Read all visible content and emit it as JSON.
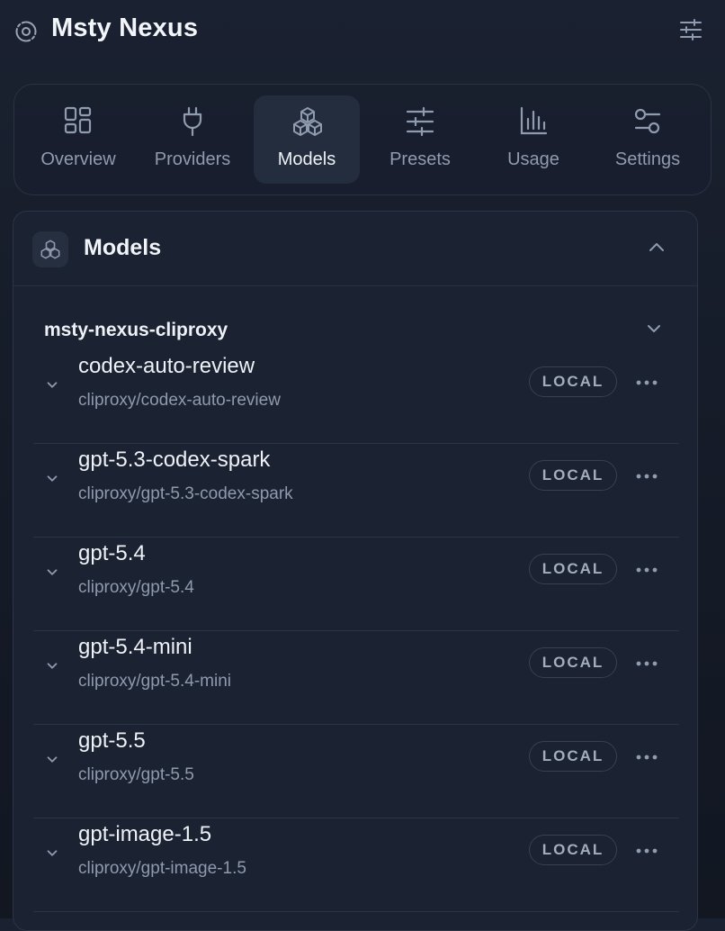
{
  "app": {
    "title": "Msty Nexus"
  },
  "nav": {
    "tabs": [
      {
        "label": "Overview",
        "icon": "grid-icon"
      },
      {
        "label": "Providers",
        "icon": "plug-icon"
      },
      {
        "label": "Models",
        "icon": "cubes-icon",
        "active": true
      },
      {
        "label": "Presets",
        "icon": "sliders-icon"
      },
      {
        "label": "Usage",
        "icon": "bar-chart-icon"
      },
      {
        "label": "Settings",
        "icon": "toggles-icon"
      }
    ]
  },
  "models_section": {
    "title": "Models",
    "group": {
      "name": "msty-nexus-cliproxy",
      "models": [
        {
          "name": "codex-auto-review",
          "path": "cliproxy/codex-auto-review",
          "badge": "LOCAL"
        },
        {
          "name": "gpt-5.3-codex-spark",
          "path": "cliproxy/gpt-5.3-codex-spark",
          "badge": "LOCAL"
        },
        {
          "name": "gpt-5.4",
          "path": "cliproxy/gpt-5.4",
          "badge": "LOCAL"
        },
        {
          "name": "gpt-5.4-mini",
          "path": "cliproxy/gpt-5.4-mini",
          "badge": "LOCAL"
        },
        {
          "name": "gpt-5.5",
          "path": "cliproxy/gpt-5.5",
          "badge": "LOCAL"
        },
        {
          "name": "gpt-image-1.5",
          "path": "cliproxy/gpt-image-1.5",
          "badge": "LOCAL"
        }
      ]
    }
  },
  "colors": {
    "background": "#161c28",
    "card": "#1b2232",
    "active_tab": "#242d3e",
    "muted_text": "#8e9aad",
    "text": "#eef2f7"
  }
}
